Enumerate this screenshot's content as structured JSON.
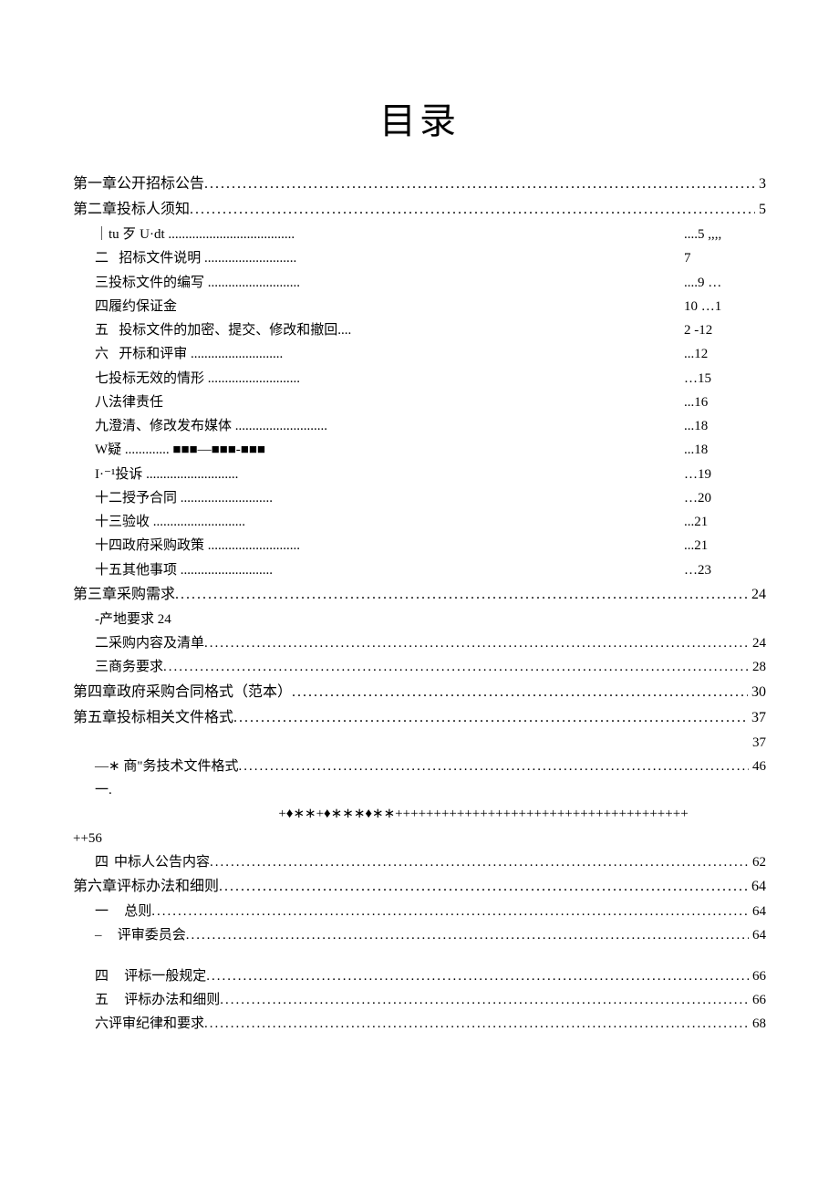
{
  "title": "目录",
  "chapter1": {
    "label": "第一章公开招标公告",
    "page": "3"
  },
  "chapter2": {
    "label": "第二章投标人须知",
    "page": "5"
  },
  "c2_s1_label": "｜tu 歹 U·dt",
  "c2_right_col": [
    "....5 ,,,,",
    "7",
    "....9 …",
    "10 …1",
    "2   -12",
    "...12",
    "…15",
    "...16",
    "...18",
    "...18",
    "…19",
    "…20",
    "...21",
    "...21",
    "…23"
  ],
  "c2_left_items": [
    {
      "num": "二",
      "label": "招标文件说明",
      "dots": true
    },
    {
      "num": "",
      "label": "三投标文件的编写",
      "dots": true
    },
    {
      "num": "",
      "label": "四履约保证金",
      "dots": false
    },
    {
      "num": "五",
      "label": "投标文件的加密、提交、修改和撤回....",
      "dots": false
    },
    {
      "num": "六",
      "label": "开标和评审",
      "dots": true
    },
    {
      "num": "",
      "label": "七投标无效的情形",
      "dots": true
    },
    {
      "num": "",
      "label": "八法律责任",
      "dots": false
    },
    {
      "num": "",
      "label": "九澄清、修改发布媒体",
      "dots": true
    },
    {
      "num": "",
      "label": "          W疑 ............. ■■■—■■■-■■■",
      "dots": false
    },
    {
      "num": "",
      "label": "I·⁻¹投诉",
      "dots": true
    },
    {
      "num": "",
      "label": "十二授予合同",
      "dots": true
    },
    {
      "num": "",
      "label": "十三验收",
      "dots": true
    },
    {
      "num": "",
      "label": "十四政府采购政策",
      "dots": true
    },
    {
      "num": "",
      "label": "十五其他事项",
      "dots": true
    }
  ],
  "chapter3": {
    "label": "第三章采购需求",
    "page": "24"
  },
  "c3_s1": {
    "label": "-产地要求 24"
  },
  "c3_s2": {
    "label": "二采购内容及清单",
    "page": "24"
  },
  "c3_s3": {
    "label": "三商务要求",
    "page": "28"
  },
  "chapter4": {
    "label": "第四章政府采购合同格式（范本）",
    "page": "30"
  },
  "chapter5": {
    "label": "第五章投标相关文件格式",
    "page": "37"
  },
  "c5_right37": "37",
  "c5_s1": {
    "label": "—∗  商\"务技术文件格式",
    "page": "46"
  },
  "c5_s2": {
    "label": "一."
  },
  "c5_symbols": "+♦∗∗+♦∗∗∗♦∗∗++++++++++++++++++++++++++++++++++++++",
  "c5_s3": {
    "label": "++56"
  },
  "c5_s4": {
    "num": "四",
    "label": "中标人公告内容",
    "page": "62"
  },
  "chapter6": {
    "label": "第六章评标办法和细则",
    "page": "64"
  },
  "c6_items": [
    {
      "num": "一",
      "label": "总则",
      "page": "64"
    },
    {
      "num": "–",
      "label": "评审委员会",
      "page": "64"
    },
    {
      "num": "",
      "label": "",
      "page": ""
    },
    {
      "num": "四",
      "label": "评标一般规定",
      "page": "66"
    },
    {
      "num": "五",
      "label": "评标办法和细则",
      "page": "66"
    },
    {
      "num": "",
      "label": "六评审纪律和要求",
      "page": "68"
    }
  ]
}
